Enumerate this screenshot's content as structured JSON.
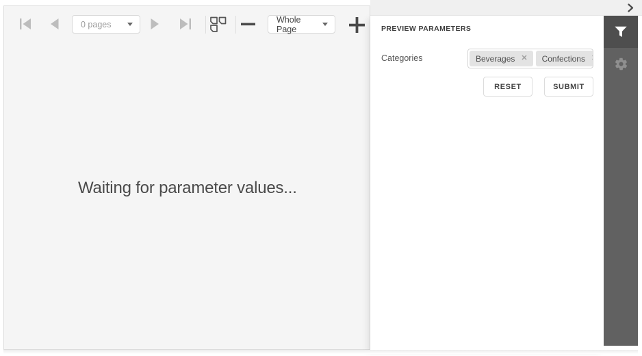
{
  "splitter": {
    "collapse_icon": "chevron-right-icon"
  },
  "toolbar": {
    "first_page_icon": "first-page-icon",
    "prev_page_icon": "previous-page-icon",
    "next_page_icon": "next-page-icon",
    "last_page_icon": "last-page-icon",
    "multipage_icon": "multi-page-view-icon",
    "zoom_out_icon": "zoom-out-icon",
    "zoom_in_icon": "zoom-in-icon",
    "pages_select": {
      "value": "0 pages"
    },
    "zoom_select": {
      "value": "Whole Page"
    }
  },
  "document_area": {
    "message": "Waiting for parameter values..."
  },
  "parameters_panel": {
    "title": "PREVIEW PARAMETERS",
    "categories": {
      "label": "Categories",
      "tags": [
        {
          "label": "Beverages"
        },
        {
          "label": "Confections"
        }
      ],
      "remove_icon": "✕"
    },
    "reset_label": "RESET",
    "submit_label": "SUBMIT"
  },
  "side_rail": {
    "items": [
      {
        "icon": "filter-icon",
        "active": true
      },
      {
        "icon": "gear-icon",
        "active": false
      }
    ]
  },
  "colors": {
    "viewer_bg": "#f5f5f5",
    "viewer_border": "#dcdcdc",
    "strip_bg": "#f0f0f0",
    "panel_bg": "#ffffff",
    "sidebar_bg": "#616161",
    "sidebar_active_bg": "#4e4e4e",
    "tag_bg": "#e3e3e3",
    "nav_icon_muted": "#bdbdbd",
    "icon_dark": "#4a4a4a",
    "message_text": "#4a4a4a"
  }
}
